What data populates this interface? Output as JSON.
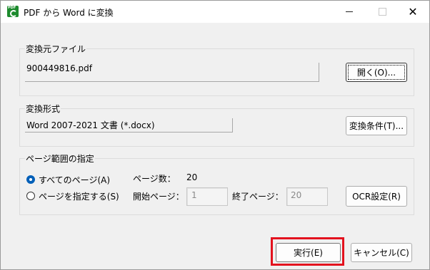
{
  "window": {
    "title": "PDF から Word に変換",
    "app_icon": "pdf-to-word-app-icon",
    "controls": {
      "minimize": "minimize-icon",
      "maximize": "maximize-icon",
      "close": "close-icon"
    }
  },
  "source": {
    "group_label": "変換元ファイル",
    "file_value": "900449816.pdf",
    "open_button": "開く(O)..."
  },
  "format": {
    "group_label": "変換形式",
    "value": "Word 2007-2021 文書 (*.docx)",
    "options_button": "変換条件(T)..."
  },
  "range": {
    "group_label": "ページ範囲の指定",
    "all_pages_label": "すべてのページ(A)",
    "specify_pages_label": "ページを指定する(S)",
    "selected": "all_pages",
    "page_count_label": "ページ数：",
    "page_count_value": "20",
    "start_label": "開始ページ：",
    "start_value": "1",
    "end_label": "終了ページ：",
    "end_value": "20",
    "ocr_button": "OCR設定(R)"
  },
  "footer": {
    "execute_button": "実行(E)",
    "cancel_button": "キャンセル(C)"
  },
  "colors": {
    "highlight_border": "#e3121e",
    "radio_selected": "#005fb8",
    "app_icon": "#1e8b2e"
  }
}
